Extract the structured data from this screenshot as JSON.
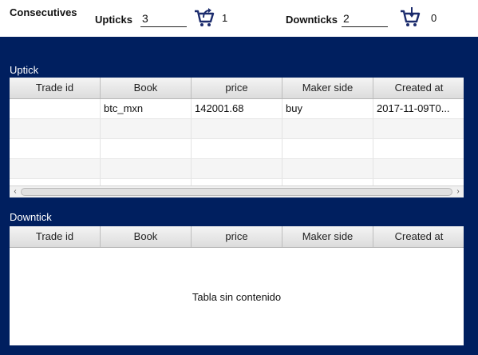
{
  "header": {
    "title": "Consecutives",
    "upticks": {
      "label": "Upticks",
      "value": "3",
      "count": "1",
      "icon": "cart-arrow-up-icon"
    },
    "downticks": {
      "label": "Downticks",
      "value": "2",
      "count": "0",
      "icon": "cart-arrow-down-icon"
    }
  },
  "uptick": {
    "title": "Uptick",
    "columns": [
      "Trade id",
      "Book",
      "price",
      "Maker side",
      "Created at"
    ],
    "rows": [
      [
        "",
        "btc_mxn",
        "142001.68",
        "buy",
        "2017-11-09T0..."
      ]
    ]
  },
  "downtick": {
    "title": "Downtick",
    "columns": [
      "Trade id",
      "Book",
      "price",
      "Maker side",
      "Created at"
    ],
    "empty_message": "Tabla sin contenido"
  },
  "colors": {
    "background": "#001f5f",
    "icon": "#1a2a6c"
  }
}
